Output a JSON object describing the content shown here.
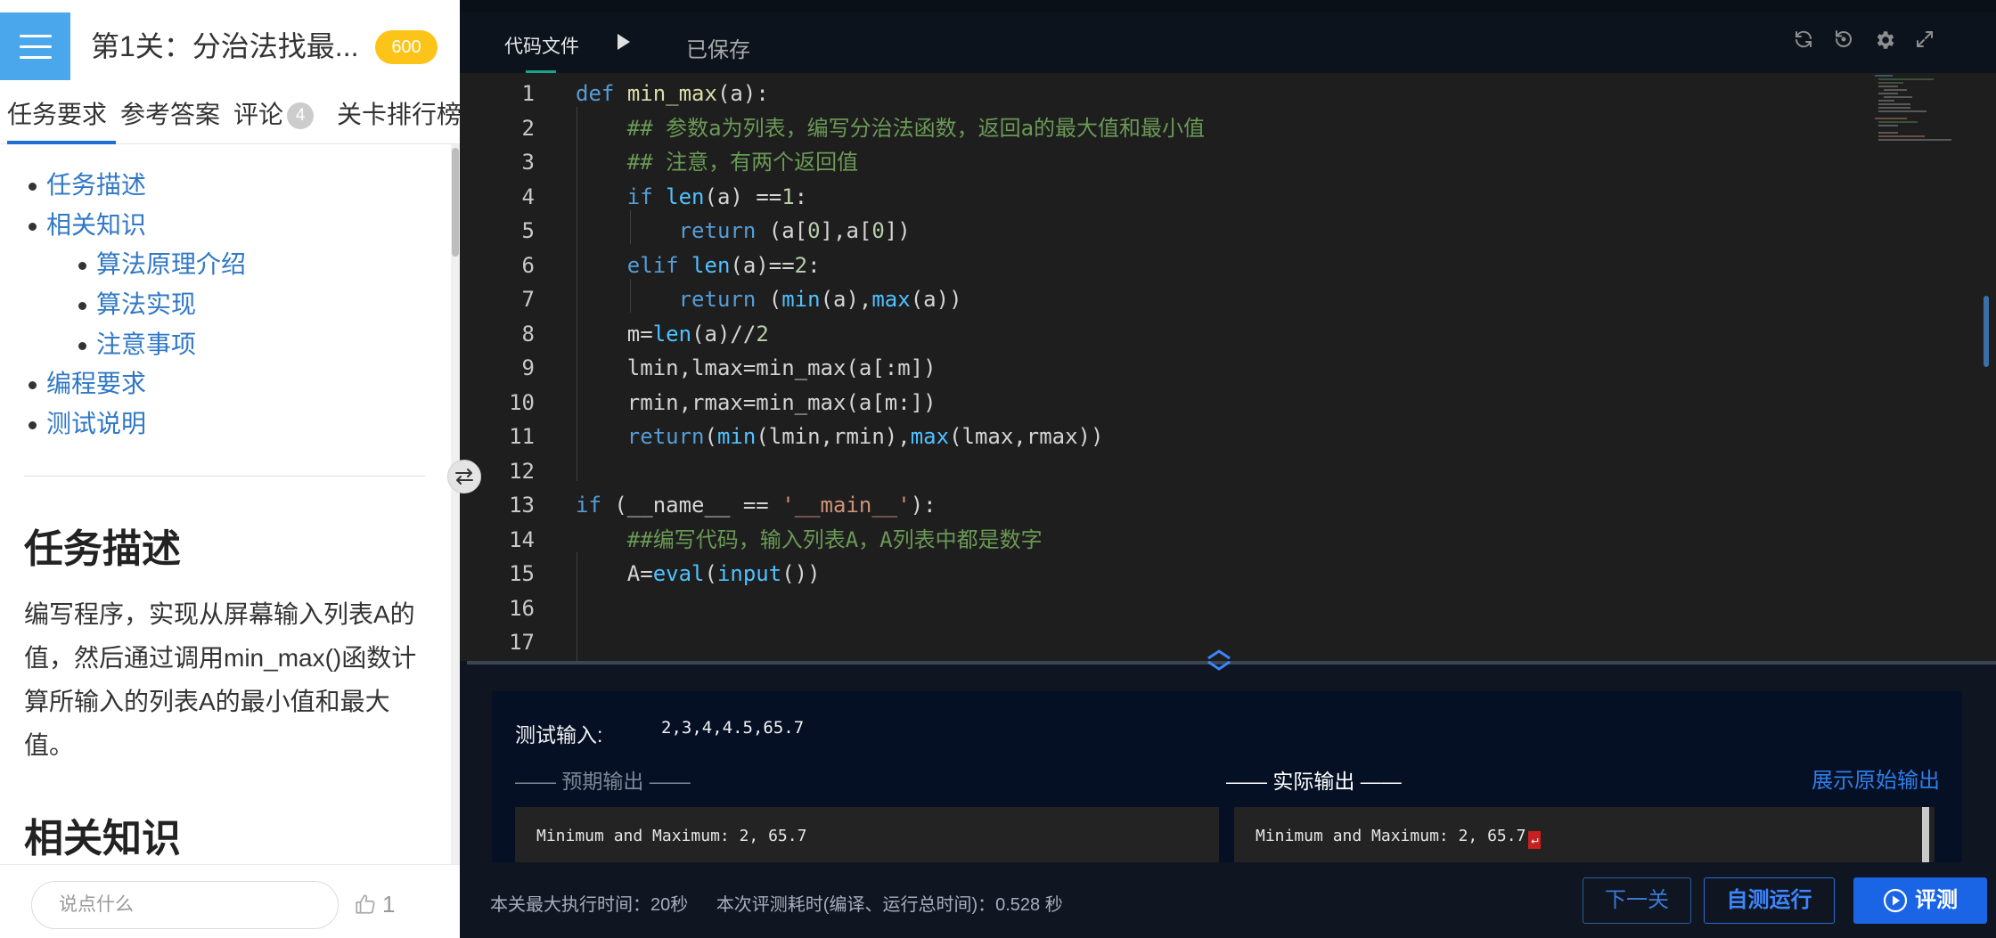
{
  "left_panel": {
    "level_title": "第1关：分治法找最...",
    "score": "600",
    "tabs": [
      {
        "label": "任务要求"
      },
      {
        "label": "参考答案"
      },
      {
        "label": "评论"
      },
      {
        "label": "关卡排行榜"
      }
    ],
    "comment_count": "4",
    "toc": [
      {
        "label": "任务描述"
      },
      {
        "label": "相关知识"
      },
      {
        "label": "算法原理介绍"
      },
      {
        "label": "算法实现"
      },
      {
        "label": "注意事项"
      },
      {
        "label": "编程要求"
      },
      {
        "label": "测试说明"
      }
    ],
    "section_title": "任务描述",
    "description": "编写程序，实现从屏幕输入列表A的值，然后通过调用min_max()函数计算所输入的列表A的最小值和最大值。",
    "section2_title": "相关知识",
    "comment_placeholder": "说点什么",
    "like_count": "1"
  },
  "editor": {
    "tab_label": "代码文件",
    "saved_status": "已保存",
    "icons": [
      "refresh-icon",
      "history-icon",
      "settings-gear-icon",
      "fullscreen-icon"
    ],
    "line_numbers": [
      "1",
      "2",
      "3",
      "4",
      "5",
      "6",
      "7",
      "8",
      "9",
      "10",
      "11",
      "12",
      "13",
      "14",
      "15",
      "16",
      "17"
    ],
    "code": [
      "def min_max(a):",
      "    ## 参数a为列表，编写分治法函数，返回a的最大值和最小值",
      "    ## 注意，有两个返回值",
      "    if len(a) ==1:",
      "        return (a[0],a[0])",
      "    elif len(a)==2:",
      "        return (min(a),max(a))",
      "    m=len(a)//2",
      "    lmin,lmax=min_max(a[:m])",
      "    rmin,rmax=min_max(a[m:])",
      "    return(min(lmin,rmin),max(lmax,rmax))",
      "",
      "if (__name__ == '__main__'):",
      "    ##编写代码，输入列表A，A列表中都是数字",
      "    A=eval(input())",
      "",
      ""
    ]
  },
  "results": {
    "test_input_label": "测试输入:",
    "test_input_value": "2,3,4,4.5,65.7",
    "expected_label": "—— 预期输出 ——",
    "actual_label": "—— 实际输出 ——",
    "show_raw_label": "展示原始输出",
    "expected_output": "Minimum and Maximum: 2, 65.7",
    "actual_output": "Minimum and Maximum: 2, 65.7",
    "newline_marker": "↵"
  },
  "bottom_bar": {
    "max_exec_time": "本关最大执行时间：20秒",
    "eval_time": "本次评测耗时(编译、运行总时间)：0.528 秒",
    "next_label": "下一关",
    "self_run_label": "自测运行",
    "evaluate_label": "评测"
  },
  "colors": {
    "accent_blue": "#1a64e6",
    "badge_yellow": "#fcc419",
    "header_blue": "#4aa7ec",
    "link_blue": "#3178c6"
  }
}
